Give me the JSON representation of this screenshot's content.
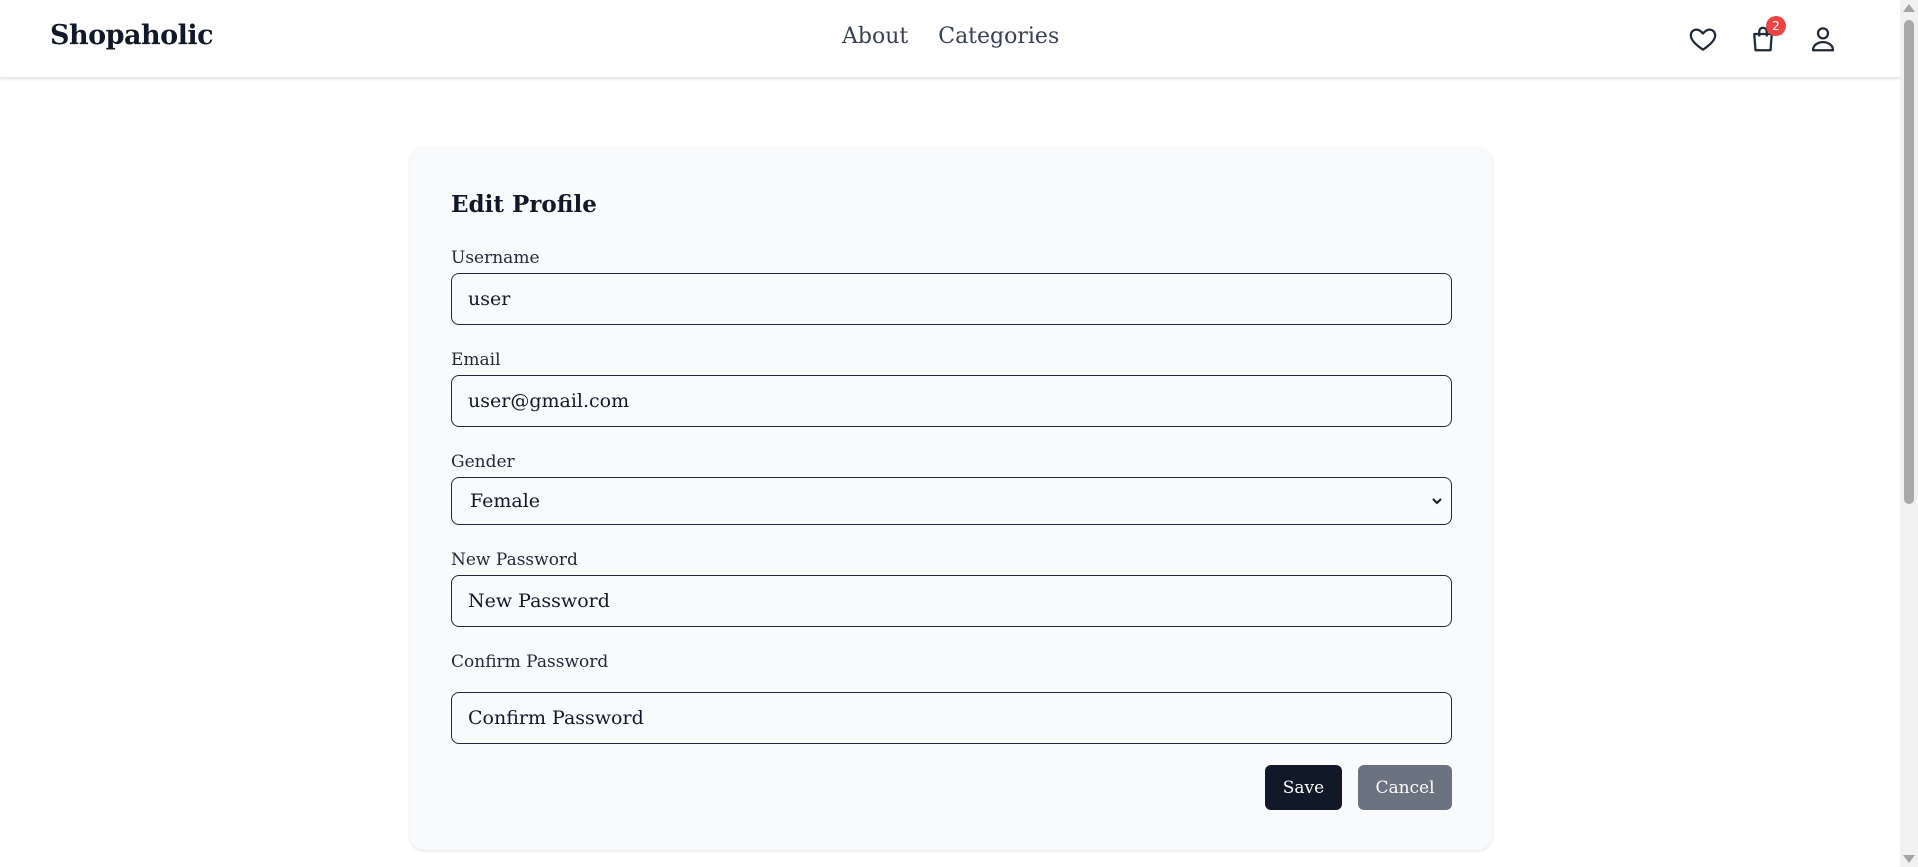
{
  "header": {
    "brand": "Shopaholic",
    "nav": [
      {
        "label": "About"
      },
      {
        "label": "Categories"
      }
    ],
    "icons": {
      "wishlist": "heart-icon",
      "cart": "shopping-bag-icon",
      "cart_count": "2",
      "account": "user-icon"
    }
  },
  "form": {
    "title": "Edit Profile",
    "username": {
      "label": "Username",
      "value": "user"
    },
    "email": {
      "label": "Email",
      "value": "user@gmail.com"
    },
    "gender": {
      "label": "Gender",
      "selected": "Female"
    },
    "new_password": {
      "label": "New Password",
      "placeholder": "New Password"
    },
    "confirm_password": {
      "label": "Confirm Password",
      "placeholder": "Confirm Password"
    },
    "save_label": "Save",
    "cancel_label": "Cancel"
  },
  "colors": {
    "primary": "#111827",
    "secondary": "#6b7280",
    "badge": "#ef4444",
    "card_bg": "#f9fafb"
  }
}
